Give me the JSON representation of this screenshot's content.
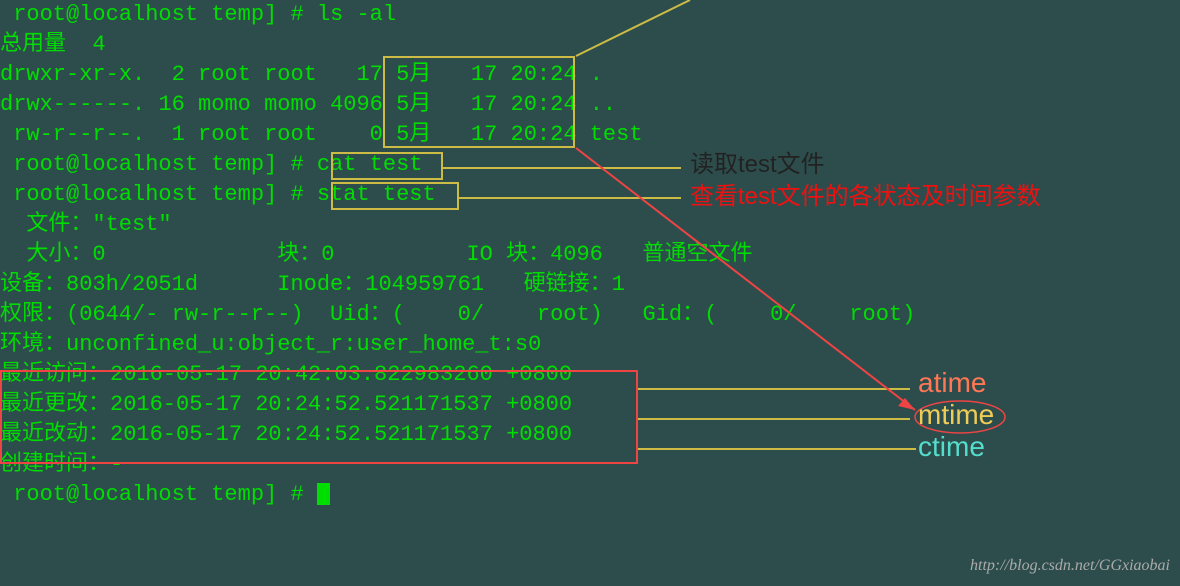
{
  "prompt_partial": " root@localhost temp] # ls -al",
  "ls": {
    "total": "总用量  4",
    "rows": [
      {
        "perm": "drwxr-xr-x.",
        "n": " 2",
        "own": "root",
        "grp": "root",
        "size": "  17",
        "mon": "5月",
        "day": "  17",
        "time": "20:24",
        "name": "."
      },
      {
        "perm": "drwx------.",
        "n": "16",
        "own": "momo",
        "grp": "momo",
        "size": "4096",
        "mon": "5月",
        "day": "  17",
        "time": "20:24",
        "name": ".."
      },
      {
        "perm": " rw-r--r--.",
        "n": " 1",
        "own": "root",
        "grp": "root",
        "size": "   0",
        "mon": "5月",
        "day": "  17",
        "time": "20:24",
        "name": "test"
      }
    ]
  },
  "cmds": {
    "cat": {
      "prompt": " root@localhost temp] # ",
      "cmd": "cat test"
    },
    "stat": {
      "prompt": " root@localhost temp] # ",
      "cmd": "stat test"
    }
  },
  "stat": {
    "file": "  文件：\"test\"",
    "size": "  大小：0             块：0          IO 块：4096   普通空文件",
    "device": "设备：803h/2051d      Inode：104959761   硬链接：1",
    "perm": "权限：(0644/- rw-r--r--)  Uid：(    0/    root)   Gid：(    0/    root)",
    "env": "环境：unconfined_u:object_r:user_home_t:s0",
    "atime": "最近访问：2016-05-17 20:42:03.822983260 +0800",
    "mtime": "最近更改：2016-05-17 20:24:52.521171537 +0800",
    "ctime": "最近改动：2016-05-17 20:24:52.521171537 +0800",
    "birth": "创建时间：-"
  },
  "prompt_end": " root@localhost temp] # ",
  "annotations": {
    "read_file": "读取test文件",
    "check_stat": "查看test文件的各状态及时间参数",
    "atime": "atime",
    "mtime": "mtime",
    "ctime": "ctime"
  },
  "watermark": "http://blog.csdn.net/GGxiaobai"
}
